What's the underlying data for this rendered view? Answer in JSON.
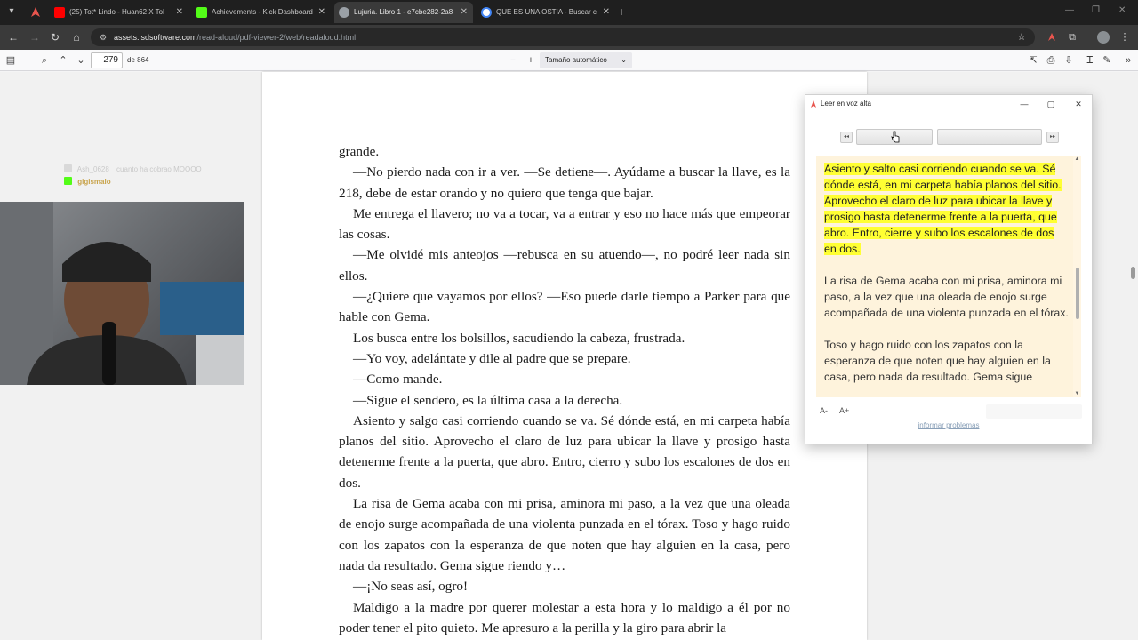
{
  "browser": {
    "tabs": [
      {
        "title": "(25) Tot* Lindo - Huan62 X Tol",
        "color": "#ff0000"
      },
      {
        "title": "Achievements - Kick Dashboard",
        "color": "#53fc18"
      },
      {
        "title": "Lujuria. Libro 1 - e7cbe282-2a8",
        "color": "#9aa0a6"
      },
      {
        "title": "QUE ES UNA OSTIA - Buscar co",
        "color": "#4285f4"
      }
    ],
    "url_host": "assets.lsdsoftware.com",
    "url_path": "/read-aloud/pdf-viewer-2/web/readaloud.html"
  },
  "pdf_toolbar": {
    "page_number": "279",
    "page_count_text": "de 864",
    "zoom": "Tamaño automático"
  },
  "chat": {
    "line1_user": "Ash_0628",
    "line1_text": "cuanto ha cobrao MOOOO",
    "line2_user": "gigismalo"
  },
  "document": {
    "paragraphs": [
      "grande.",
      "—No pierdo nada con ir a ver. —Se detiene—. Ayúdame a buscar la llave, es la 218, debe de estar orando y no quiero que tenga que bajar.",
      "Me entrega el llavero; no va a tocar, va a entrar y eso no hace más que empeorar las cosas.",
      "—Me olvidé mis anteojos —rebusca en su atuendo—, no podré leer nada sin ellos.",
      "—¿Quiere que vayamos por ellos? —Eso puede darle tiempo a Parker para que hable con Gema.",
      "Los busca entre los bolsillos, sacudiendo la cabeza, frustrada.",
      "—Yo voy, adelántate y dile al padre que se prepare.",
      "—Como mande.",
      "—Sigue el sendero, es la última casa a la derecha.",
      "Asiento y salgo casi corriendo cuando se va. Sé dónde está, en mi carpeta había planos del sitio. Aprovecho el claro de luz para ubicar la llave y prosigo hasta detenerme frente a la puerta, que abro. Entro, cierro y subo los escalones de dos en dos.",
      "La risa de Gema acaba con mi prisa, aminora mi paso, a la vez que una oleada de enojo surge acompañada de una violenta punzada en el tórax. Toso y hago ruido con los zapatos con la esperanza de que noten que hay alguien en la casa, pero nada da resultado. Gema sigue riendo y…",
      "—¡No seas así, ogro!",
      "Maldigo a la madre por querer molestar a esta hora y lo maldigo a él por no poder tener el pito quieto. Me apresuro a la perilla y la giro para abrir la"
    ]
  },
  "read_aloud": {
    "title": "Leer en voz alta",
    "highlighted": "Asiento y salto casi corriendo cuando se va. Sé dónde está, en mi carpeta había planos del sitio. Aprovecho el claro de luz para ubicar la llave y prosigo hasta detenerme frente a la puerta, que abro. Entro, cierre y subo los escalones de dos en dos.",
    "para2": "La risa de Gema acaba con mi prisa, aminora mi paso, a la vez que una oleada de enojo surge acompañada de una violenta punzada en el tórax.",
    "para3": "Toso y hago ruido con los zapatos con la esperanza de que noten que hay alguien en la casa, pero nada da resultado. Gema sigue",
    "font_decrease": "A-",
    "font_increase": "A+",
    "report_link": "informar problemas",
    "highlight_color": "#ffff33"
  }
}
